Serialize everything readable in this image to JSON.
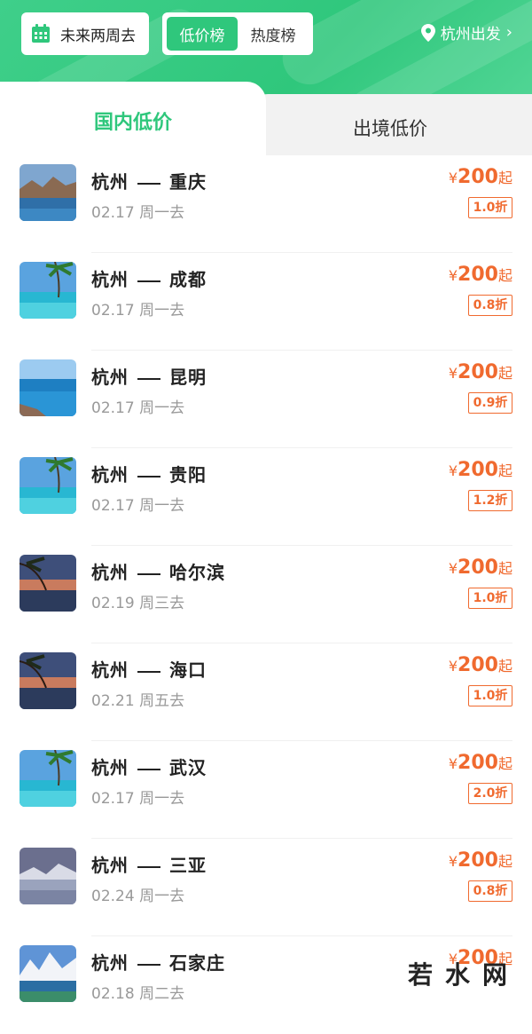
{
  "filter": {
    "date_label": "未来两周去",
    "rank_tabs": [
      "低价榜",
      "热度榜"
    ],
    "depart_label": "杭州出发"
  },
  "tabs": {
    "domestic": "国内低价",
    "international": "出境低价"
  },
  "items": [
    {
      "from": "杭州",
      "to": "重庆",
      "date": "02.17 周一去",
      "currency": "¥",
      "price": "200",
      "suffix": "起",
      "discount": "1.0折",
      "thumb": "mountain-lake"
    },
    {
      "from": "杭州",
      "to": "成都",
      "date": "02.17 周一去",
      "currency": "¥",
      "price": "200",
      "suffix": "起",
      "discount": "0.8折",
      "thumb": "palm-pool"
    },
    {
      "from": "杭州",
      "to": "昆明",
      "date": "02.17 周一去",
      "currency": "¥",
      "price": "200",
      "suffix": "起",
      "discount": "0.9折",
      "thumb": "sea-coast"
    },
    {
      "from": "杭州",
      "to": "贵阳",
      "date": "02.17 周一去",
      "currency": "¥",
      "price": "200",
      "suffix": "起",
      "discount": "1.2折",
      "thumb": "palm-pool"
    },
    {
      "from": "杭州",
      "to": "哈尔滨",
      "date": "02.19 周三去",
      "currency": "¥",
      "price": "200",
      "suffix": "起",
      "discount": "1.0折",
      "thumb": "sunset-palm"
    },
    {
      "from": "杭州",
      "to": "海口",
      "date": "02.21 周五去",
      "currency": "¥",
      "price": "200",
      "suffix": "起",
      "discount": "1.0折",
      "thumb": "sunset-palm"
    },
    {
      "from": "杭州",
      "to": "武汉",
      "date": "02.17 周一去",
      "currency": "¥",
      "price": "200",
      "suffix": "起",
      "discount": "2.0折",
      "thumb": "palm-pool"
    },
    {
      "from": "杭州",
      "to": "三亚",
      "date": "02.24 周一去",
      "currency": "¥",
      "price": "200",
      "suffix": "起",
      "discount": "0.8折",
      "thumb": "misty-lake"
    },
    {
      "from": "杭州",
      "to": "石家庄",
      "date": "02.18 周二去",
      "currency": "¥",
      "price": "200",
      "suffix": "起",
      "discount": "",
      "thumb": "snow-mountain"
    }
  ],
  "watermark": "若水网",
  "colors": {
    "brand": "#2fc77c",
    "price": "#f06a2f",
    "muted": "#999999"
  }
}
